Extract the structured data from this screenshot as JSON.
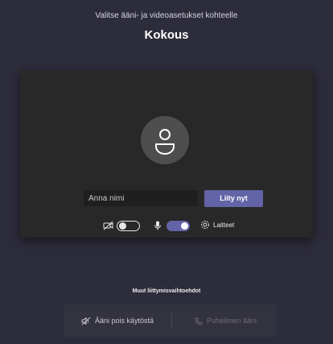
{
  "header": {
    "subtitle": "Valitse ääni- ja videoasetukset kohteelle",
    "title": "Kokous"
  },
  "preview": {
    "avatar_icon": "user-icon",
    "name_placeholder": "Anna nimi",
    "name_value": "",
    "join_label": "Liity nyt"
  },
  "controls": {
    "camera_icon": "camera-off-icon",
    "camera_on": false,
    "mic_icon": "microphone-icon",
    "mic_on": true,
    "devices_icon": "gear-icon",
    "devices_label": "Laitteet"
  },
  "other": {
    "heading": "Muut liittymisvaihtoehdot",
    "audio_off_label": "Ääni pois käytöstä",
    "audio_off_icon": "speaker-off-icon",
    "phone_label": "Puhelimen ääni",
    "phone_icon": "phone-icon"
  },
  "colors": {
    "background": "#2d2c3b",
    "accent": "#6264a7",
    "panel": "#292828"
  }
}
